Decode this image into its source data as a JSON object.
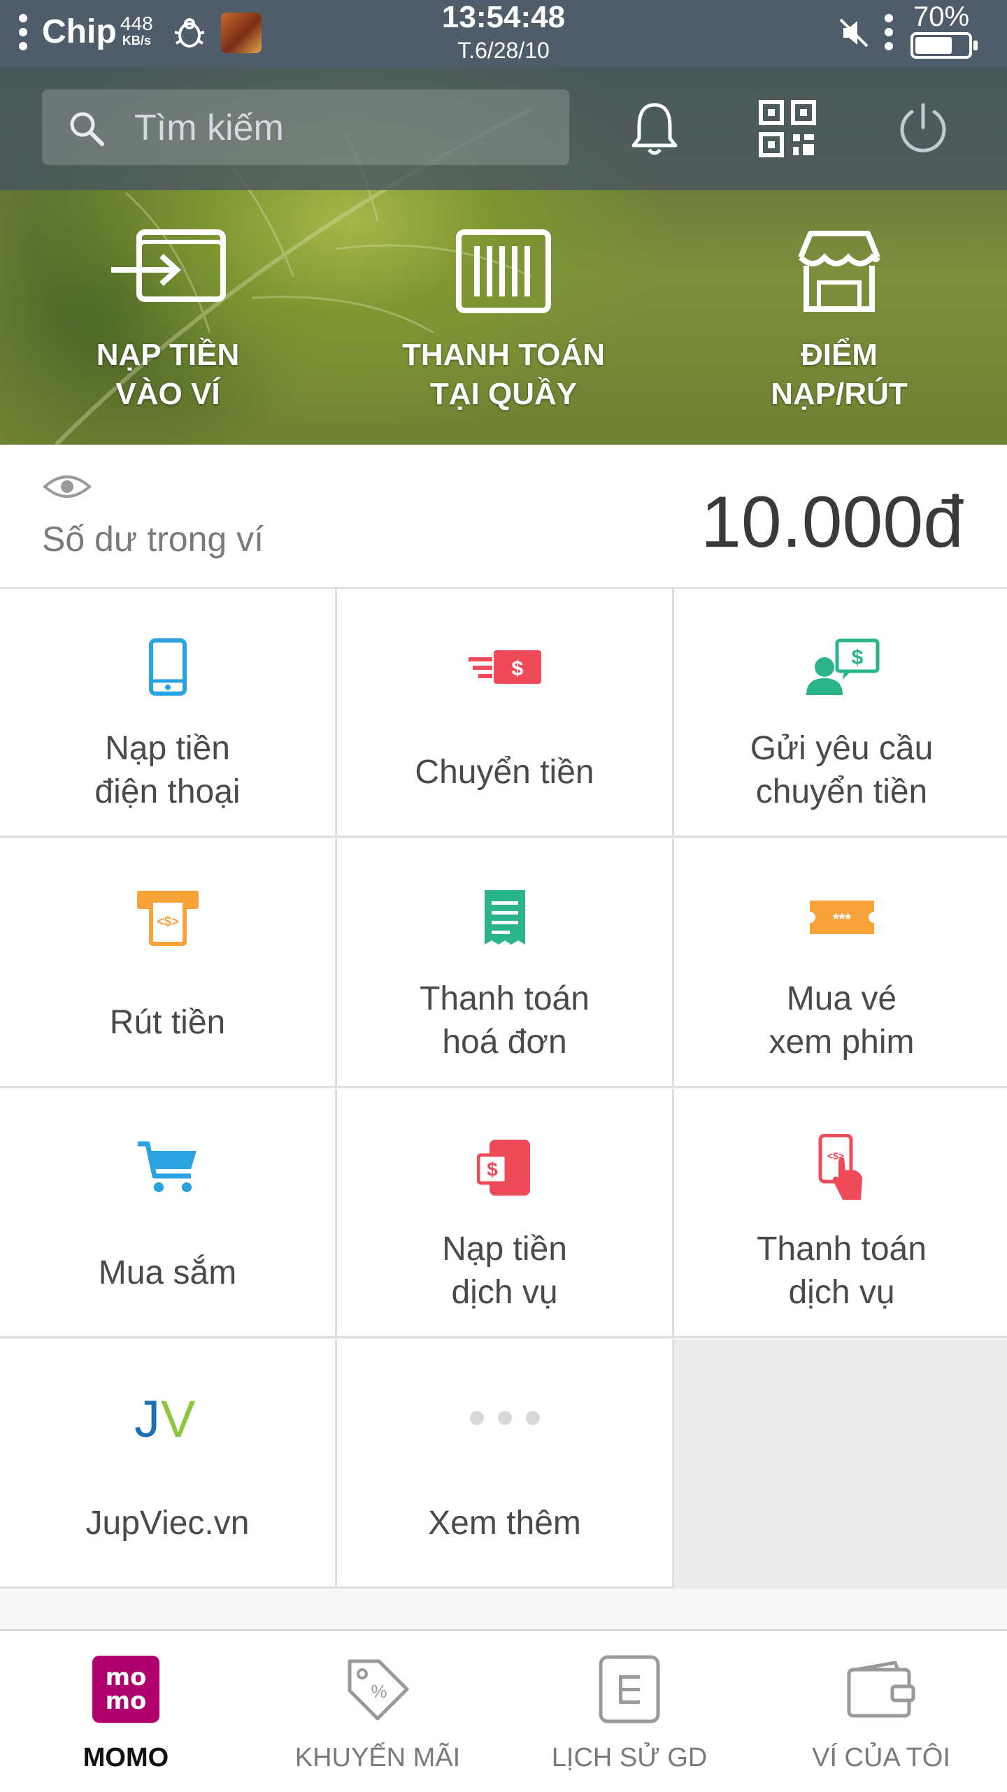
{
  "status_bar": {
    "carrier": "Chip",
    "net_speed": "448",
    "net_unit": "KB/s",
    "time": "13:54:48",
    "date": "T.6/28/10",
    "battery": "70%",
    "battery_level": 0.7
  },
  "header": {
    "search_placeholder": "Tìm kiếm",
    "icons": [
      "bell-icon",
      "qr-code-icon",
      "power-icon"
    ]
  },
  "quick_actions": [
    {
      "label": "NẠP TIỀN\nVÀO VÍ",
      "icon": "wallet-in-icon"
    },
    {
      "label": "THANH TOÁN\nTẠI QUẦY",
      "icon": "barcode-icon"
    },
    {
      "label": "ĐIỂM\nNẠP/RÚT",
      "icon": "store-icon"
    }
  ],
  "balance": {
    "label": "Số dư trong ví",
    "value": "10.000đ"
  },
  "services": [
    {
      "label": "Nạp tiền\nđiện thoại",
      "icon": "phone-icon"
    },
    {
      "label": "Chuyển tiền",
      "icon": "money-transfer-icon"
    },
    {
      "label": "Gửi yêu cầu\nchuyển tiền",
      "icon": "request-money-icon"
    },
    {
      "label": "Rút tiền",
      "icon": "atm-withdraw-icon"
    },
    {
      "label": "Thanh toán\nhoá đơn",
      "icon": "bill-icon"
    },
    {
      "label": "Mua vé\nxem phim",
      "icon": "ticket-icon"
    },
    {
      "label": "Mua sắm",
      "icon": "cart-icon"
    },
    {
      "label": "Nạp tiền\ndịch vụ",
      "icon": "service-topup-icon"
    },
    {
      "label": "Thanh toán\ndịch vụ",
      "icon": "service-pay-icon"
    },
    {
      "label": "JupViec.vn",
      "icon": "jupviec-logo",
      "logo_text": "JV"
    },
    {
      "label": "Xem thêm",
      "icon": "more-dots-icon"
    }
  ],
  "bottom_nav": [
    {
      "label": "MOMO",
      "icon": "momo-logo",
      "logo_text": "mo mo",
      "active": true
    },
    {
      "label": "KHUYẾN MÃI",
      "icon": "promo-tag-icon",
      "active": false
    },
    {
      "label": "LỊCH SỬ GD",
      "icon": "history-icon",
      "active": false
    },
    {
      "label": "VÍ CỦA TÔI",
      "icon": "wallet-icon",
      "active": false
    }
  ],
  "colors": {
    "brand": "#b0006d",
    "blue": "#29a3e0",
    "red": "#ef4a57",
    "green": "#2bb38c",
    "orange": "#f7a239"
  }
}
